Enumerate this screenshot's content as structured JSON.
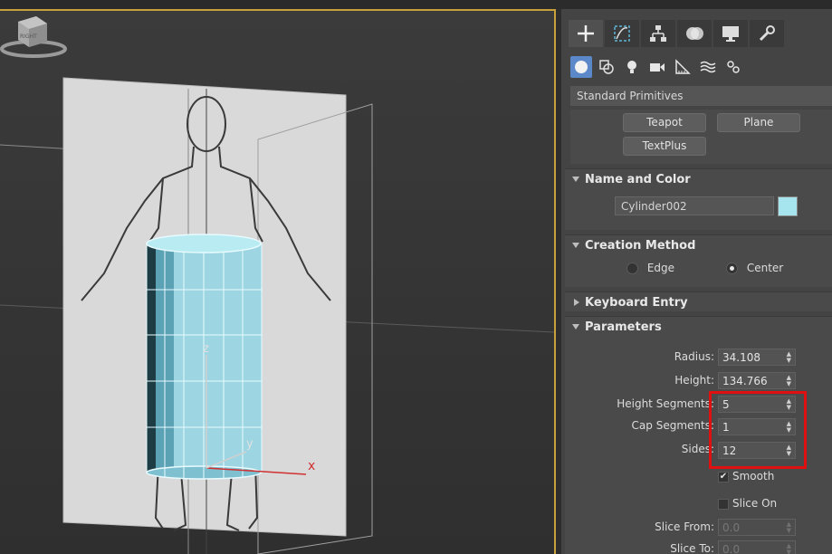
{
  "viewport": {
    "axis_labels": {
      "x": "x",
      "y": "y",
      "z": "z"
    },
    "viewcube_label": "RIGHT"
  },
  "command_panel": {
    "tabs": [
      "create-icon",
      "modify-icon",
      "hierarchy-icon",
      "motion-icon",
      "display-icon",
      "utilities-icon"
    ],
    "subtabs": [
      "geometry-icon",
      "shapes-icon",
      "lights-icon",
      "cameras-icon",
      "helpers-icon",
      "spacewarps-icon",
      "systems-icon"
    ],
    "category_dropdown": "Standard Primitives",
    "object_buttons": {
      "teapot": "Teapot",
      "plane": "Plane",
      "textplus": "TextPlus"
    },
    "name_and_color": {
      "title": "Name and Color",
      "name": "Cylinder002",
      "color": "#a6e4ee"
    },
    "creation_method": {
      "title": "Creation Method",
      "edge": "Edge",
      "center": "Center",
      "selected": "Center"
    },
    "keyboard_entry": {
      "title": "Keyboard Entry"
    },
    "parameters": {
      "title": "Parameters",
      "radius_label": "Radius:",
      "radius": "34.108",
      "height_label": "Height:",
      "height": "134.766",
      "height_segments_label": "Height Segments:",
      "height_segments": "5",
      "cap_segments_label": "Cap Segments:",
      "cap_segments": "1",
      "sides_label": "Sides:",
      "sides": "12",
      "smooth_label": "Smooth",
      "smooth_checked": true,
      "slice_on_label": "Slice On",
      "slice_on_checked": false,
      "slice_from_label": "Slice From:",
      "slice_from": "0.0",
      "slice_to_label": "Slice To:",
      "slice_to": "0.0"
    }
  },
  "colors": {
    "viewport_border": "#c7a23a",
    "highlight_box": "#e01010",
    "active_subtab": "#5b88c8",
    "cylinder": "#a6e4ee"
  }
}
